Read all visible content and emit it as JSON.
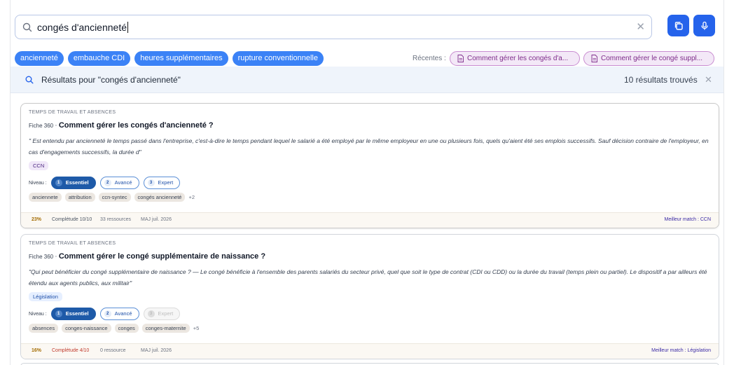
{
  "search": {
    "query": "congés d'ancienneté",
    "clear_icon": "close-icon",
    "copy_icon": "copy-icon",
    "mic_icon": "microphone-icon"
  },
  "suggestion_chips": [
    "ancienneté",
    "embauche CDI",
    "heures supplémentaires",
    "rupture conventionnelle"
  ],
  "recent": {
    "label": "Récentes :",
    "items": [
      "Comment gérer les congés d'a...",
      "Comment gérer le congé suppl..."
    ]
  },
  "results_bar": {
    "title": "Résultats pour \"congés d'ancienneté\"",
    "count": "10 résultats trouvés"
  },
  "level_label": "Niveau :",
  "results": [
    {
      "category": "TEMPS DE TRAVAIL ET ABSENCES",
      "prefix": "Fiche 360",
      "separator": "·",
      "title": "Comment gérer les congés d'ancienneté ?",
      "excerpt": "\" Est entendu par ancienneté le temps passé dans l'entreprise, c'est-à-dire le temps pendant lequel le salarié a été employé par le même employeur en une ou plusieurs fois, quels qu'aient été ses emplois successifs. Sauf décision contraire de l'employeur, en cas d'engagements successifs, la durée d\"",
      "source": "CCN",
      "levels": [
        {
          "num": "1",
          "label": "Essentiel"
        },
        {
          "num": "2",
          "label": "Avancé"
        },
        {
          "num": "3",
          "label": "Expert"
        }
      ],
      "tags": [
        "anciennete",
        "attribution",
        "ccn-syntec",
        "congés ancienneté"
      ],
      "more": "+2",
      "completion_pct": "23%",
      "completion": "Complétude 10/10",
      "resources": "33 ressources",
      "updated": "MAJ juil. 2026",
      "best_match": "Meilleur match : CCN"
    },
    {
      "category": "TEMPS DE TRAVAIL ET ABSENCES",
      "prefix": "Fiche 360",
      "separator": "·",
      "title": "Comment gérer le congé supplémentaire de naissance ?",
      "excerpt": "\"Qui peut bénéficier du congé supplémentaire de naissance ? — Le congé bénéficie à l'ensemble des parents salariés du secteur privé, quel que soit le type de contrat (CDI ou CDD) ou la durée du travail (temps plein ou partiel). Le dispositif a par ailleurs été étendu aux agents publics, aux militair\"",
      "source": "Législation",
      "levels": [
        {
          "num": "1",
          "label": "Essentiel"
        },
        {
          "num": "2",
          "label": "Avancé"
        },
        {
          "num": "3",
          "label": "Expert"
        }
      ],
      "tags": [
        "absences",
        "conges-naissance",
        "conges",
        "conges-maternite"
      ],
      "more": "+5",
      "completion_pct": "16%",
      "completion": "Complétude 4/10",
      "resources": "0 ressource",
      "updated": "MAJ juil. 2026",
      "best_match": "Meilleur match : Législation"
    }
  ],
  "colors": {
    "accent": "#2563eb",
    "chip": "#3b82f6",
    "recent_bg": "#f3e8f7",
    "level_active": "#1e5aa8"
  }
}
